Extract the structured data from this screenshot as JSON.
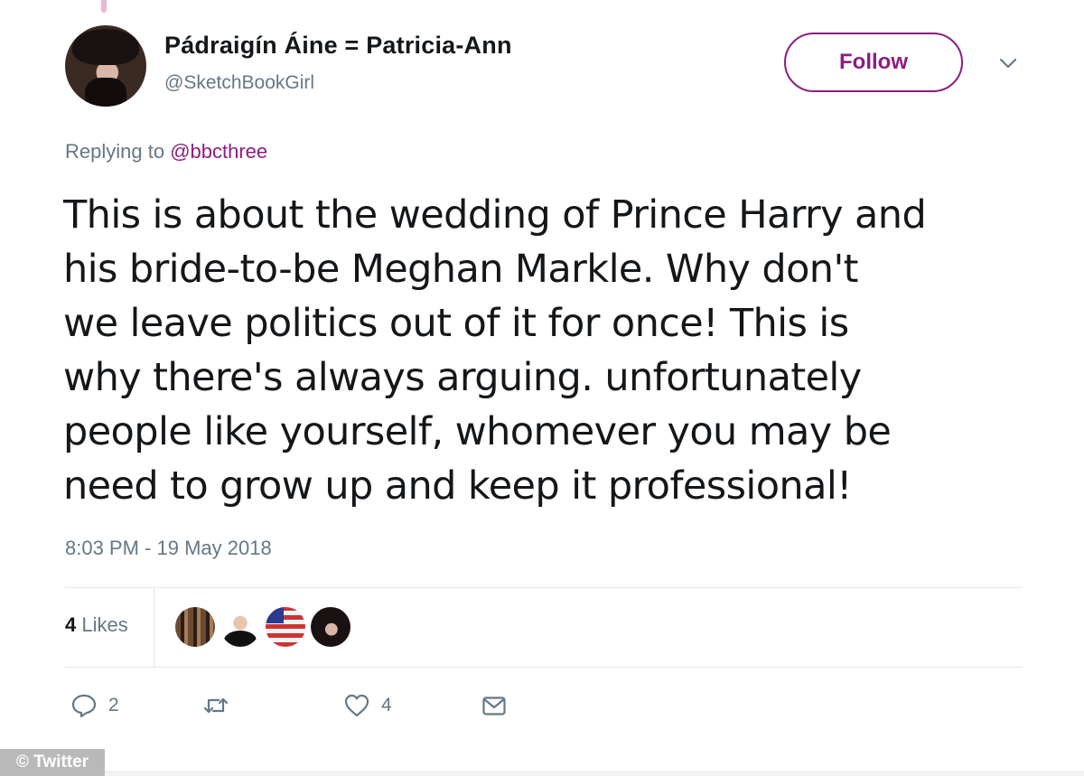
{
  "tweet": {
    "author": {
      "display_name": "Pádraigín Áine = Patricia-Ann",
      "handle": "@SketchBookGirl"
    },
    "follow_label": "Follow",
    "reply_prefix": "Replying to",
    "reply_to": "@bbcthree",
    "text": "This is about the wedding of Prince Harry and\nhis bride-to-be Meghan Markle. Why don't\nwe leave politics out of it for once!  This is\nwhy there's always arguing. unfortunately\npeople like yourself, whomever you may be\nneed to grow up and keep it professional!",
    "timestamp": "8:03 PM - 19 May 2018",
    "likes": {
      "count": "4",
      "label": "Likes"
    },
    "actions": {
      "reply_count": "2",
      "like_count": "4"
    }
  },
  "watermark": "© Twitter",
  "colors": {
    "accent": "#8c1d82",
    "secondary_text": "#657786",
    "primary_text": "#14171a",
    "divider": "#e1e8ed"
  },
  "icons": [
    "chevron-down-icon",
    "reply-icon",
    "retweet-icon",
    "heart-icon",
    "envelope-icon"
  ]
}
